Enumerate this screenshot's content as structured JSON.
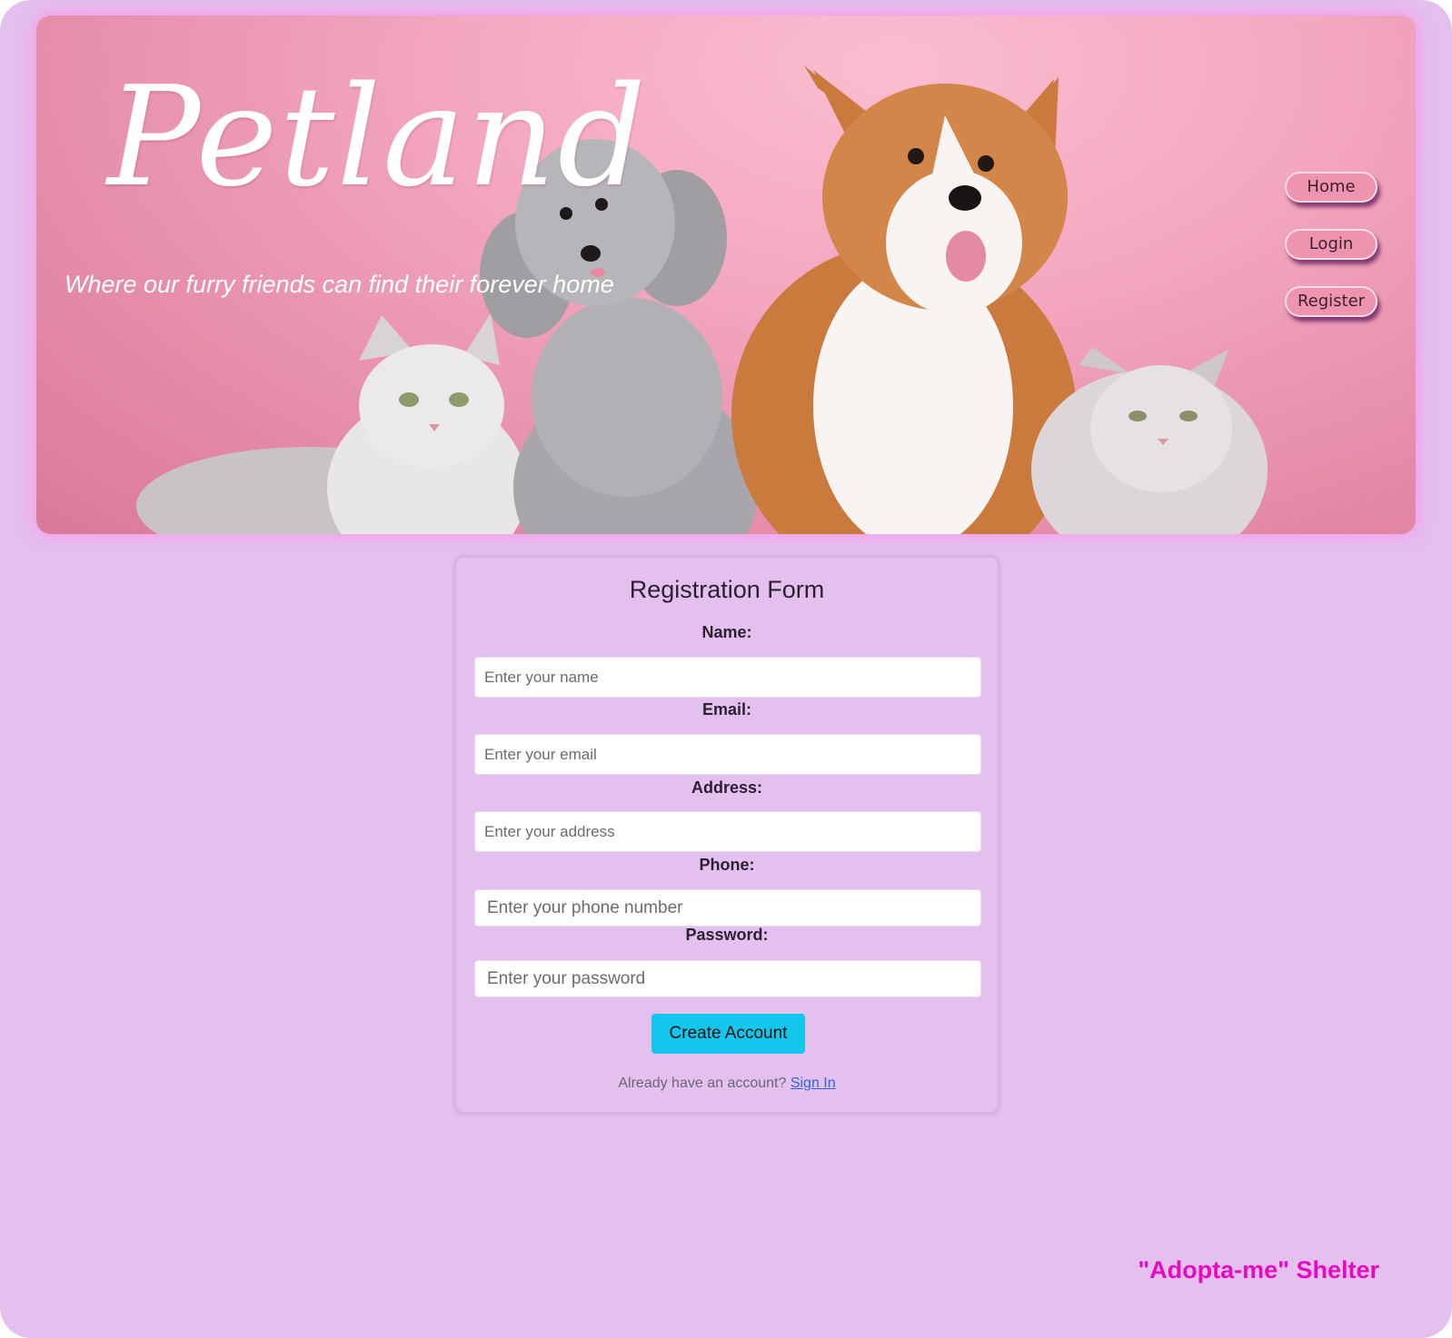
{
  "header": {
    "brand": "Petland",
    "tagline": "Where our furry friends can find their forever home",
    "image_alt": "two cats, a grey poodle and a corgi on a pink background"
  },
  "nav": {
    "home": "Home",
    "login": "Login",
    "register": "Register"
  },
  "form": {
    "title": "Registration Form",
    "fields": [
      {
        "label": "Name:",
        "placeholder": "Enter your name"
      },
      {
        "label": "Email:",
        "placeholder": "Enter your email"
      },
      {
        "label": "Address:",
        "placeholder": "Enter your address"
      },
      {
        "label": "Phone:",
        "placeholder": "Enter your phone number"
      },
      {
        "label": "Password:",
        "placeholder": "Enter your password"
      }
    ],
    "submit_label": "Create Account",
    "signin_prompt": "Already have an account?",
    "signin_link": "Sign In"
  },
  "footer": {
    "text": "\"Adopta-me\" Shelter"
  },
  "colors": {
    "page_background": "#e4c0ee",
    "hero_pink": "#f4a8c0",
    "nav_button": "#ef94ae",
    "submit_button": "#12c6ec",
    "footer_text": "#e60ac2",
    "link": "#2f66e0"
  }
}
